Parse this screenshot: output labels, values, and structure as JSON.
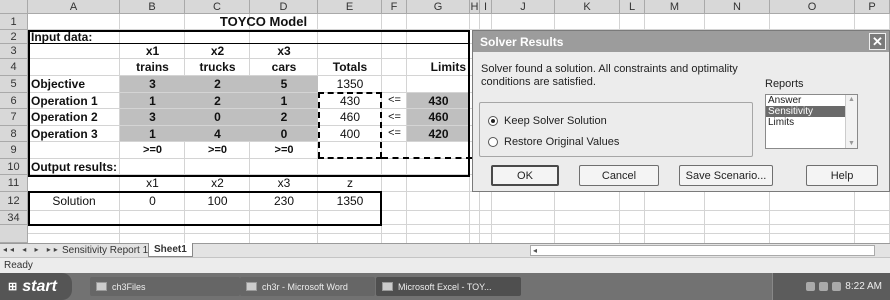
{
  "sheet": {
    "columns": [
      "A",
      "B",
      "C",
      "D",
      "E",
      "F",
      "G",
      "H",
      "I",
      "J",
      "K",
      "L",
      "M",
      "N",
      "O",
      "P"
    ],
    "rows": [
      "1",
      "2",
      "3",
      "4",
      "5",
      "6",
      "7",
      "8",
      "9",
      "10",
      "11",
      "12",
      "34"
    ],
    "title": "TOYCO Model",
    "input_label": "Input data:",
    "var_headers": [
      "x1",
      "x2",
      "x3"
    ],
    "var_names": [
      "trains",
      "trucks",
      "cars"
    ],
    "totals_header": "Totals",
    "limits_header": "Limits",
    "objective": {
      "label": "Objective",
      "coeffs": [
        "3",
        "2",
        "5"
      ],
      "total": "1350"
    },
    "constraints": [
      {
        "label": "Operation 1",
        "coeffs": [
          "1",
          "2",
          "1"
        ],
        "total": "430",
        "sign": "<=",
        "limit": "430"
      },
      {
        "label": "Operation 2",
        "coeffs": [
          "3",
          "0",
          "2"
        ],
        "total": "460",
        "sign": "<=",
        "limit": "460"
      },
      {
        "label": "Operation 3",
        "coeffs": [
          "1",
          "4",
          "0"
        ],
        "total": "400",
        "sign": "<=",
        "limit": "420"
      }
    ],
    "nonneg": [
      ">=0",
      ">=0",
      ">=0"
    ],
    "output_label": "Output results:",
    "out_headers": [
      "x1",
      "x2",
      "x3",
      "z"
    ],
    "solution": {
      "label": "Solution",
      "values": [
        "0",
        "100",
        "230",
        "1350"
      ]
    }
  },
  "dialog": {
    "title": "Solver Results",
    "close_glyph": "✕",
    "message": "Solver found a solution.  All constraints and optimality conditions are satisfied.",
    "options": [
      "Keep Solver Solution",
      "Restore Original Values"
    ],
    "selected_option": 0,
    "reports_label": "Reports",
    "reports": [
      "Answer",
      "Sensitivity",
      "Limits"
    ],
    "selected_report": 1,
    "buttons": {
      "ok": "OK",
      "cancel": "Cancel",
      "save": "Save Scenario...",
      "help": "Help"
    }
  },
  "tabs": {
    "nav": "◂◂ ◂ ▸ ▸▸",
    "items": [
      "Sensitivity Report 1",
      "Sheet1"
    ],
    "active": "Sheet1"
  },
  "status": {
    "text": "Ready"
  },
  "taskbar": {
    "start": "start",
    "items": [
      "ch3Files",
      "ch3r - Microsoft Word",
      "Microsoft Excel - TOY..."
    ],
    "clock": "8:22 AM"
  }
}
